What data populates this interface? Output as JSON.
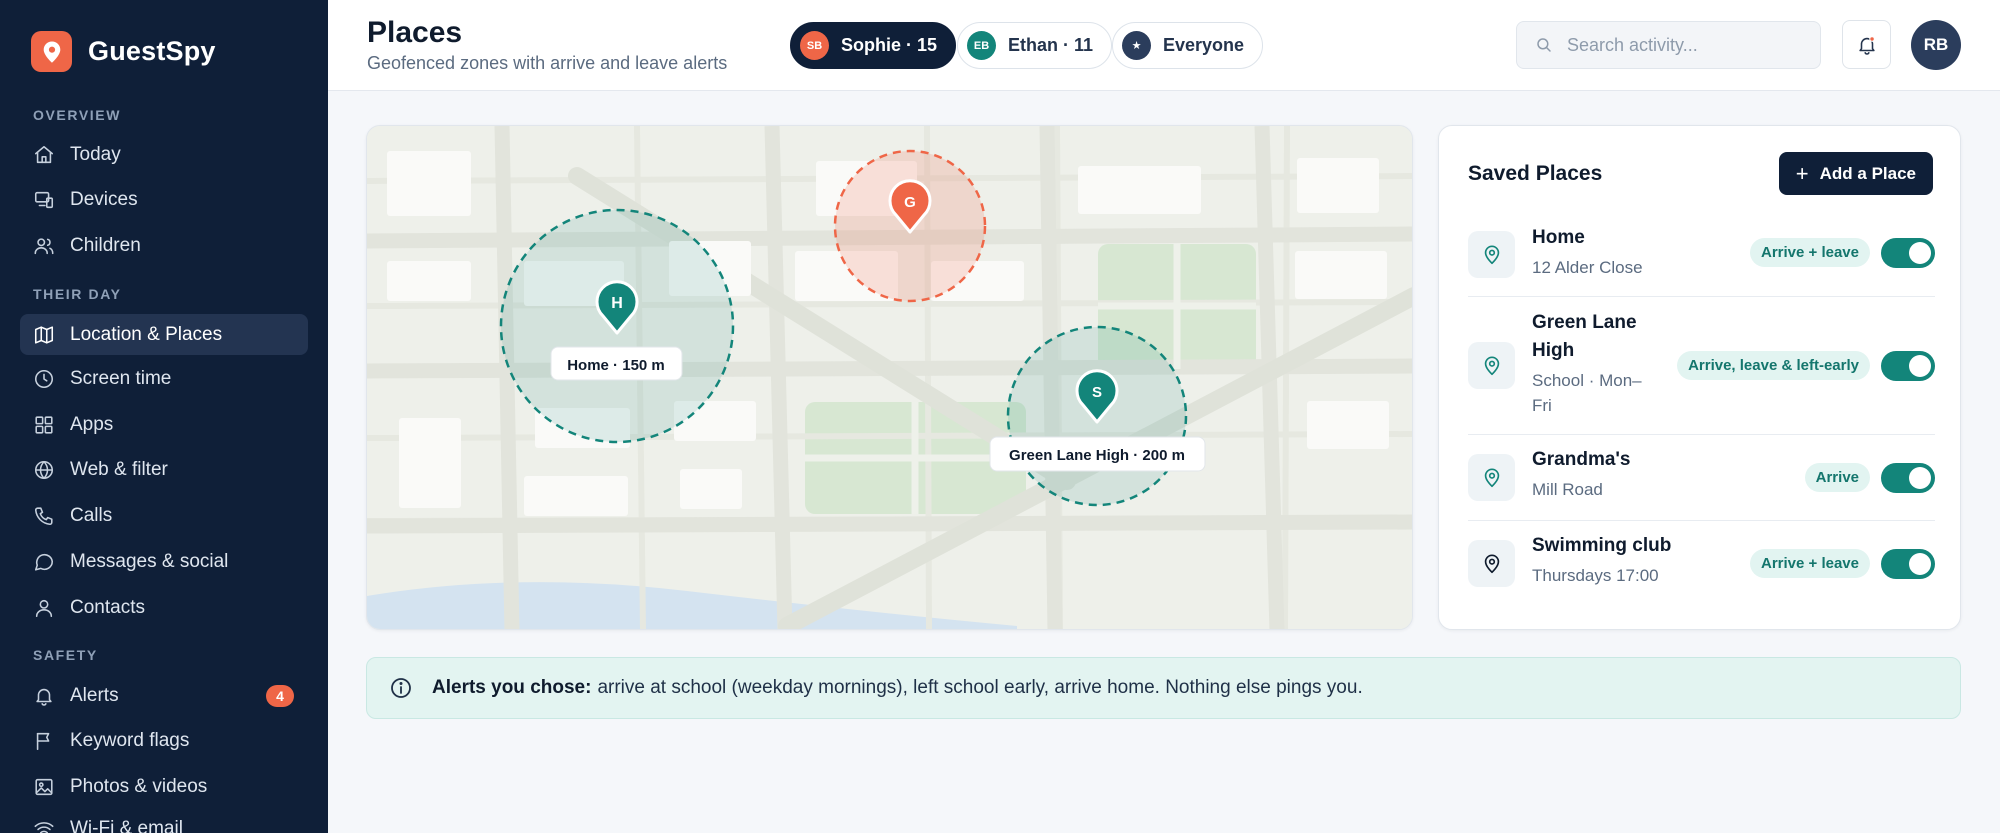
{
  "app": {
    "name": "GuestSpy"
  },
  "sidebar": {
    "sections": {
      "overview": "OVERVIEW",
      "their_day": "THEIR DAY",
      "safety": "SAFETY"
    },
    "items": {
      "today": "Today",
      "devices": "Devices",
      "children": "Children",
      "location": "Location & Places",
      "screen_time": "Screen time",
      "apps": "Apps",
      "web": "Web & filter",
      "calls": "Calls",
      "messages": "Messages & social",
      "contacts": "Contacts",
      "alerts": "Alerts",
      "alerts_badge": "4",
      "keyword": "Keyword flags",
      "photos": "Photos & videos",
      "wifi": "Wi-Fi & email"
    }
  },
  "header": {
    "title": "Places",
    "subtitle": "Geofenced zones with arrive and leave alerts",
    "chips": [
      {
        "initials": "SB",
        "label": "Sophie · 15",
        "color": "#ef6647",
        "active": true
      },
      {
        "initials": "EB",
        "label": "Ethan · 11",
        "color": "#13857a",
        "active": false
      },
      {
        "initials": "★",
        "label": "Everyone",
        "color": "#2b3d5c",
        "active": false
      }
    ],
    "search_placeholder": "Search activity...",
    "avatar": "RB"
  },
  "map": {
    "zones": [
      {
        "marker": "H",
        "label": "Home · 150 m",
        "color": "#13857a"
      },
      {
        "marker": "G",
        "label": "",
        "color": "#ef6647"
      },
      {
        "marker": "S",
        "label": "Green Lane High · 200 m",
        "color": "#13857a"
      }
    ]
  },
  "places": {
    "title": "Saved Places",
    "add_label": "Add a Place",
    "items": [
      {
        "name": "Home",
        "sub": "12 Alder Close",
        "badge": "Arrive + leave",
        "enabled": true
      },
      {
        "name_line1": "Green Lane",
        "name_line2": "High",
        "sub_line1": "School · Mon–",
        "sub_line2": "Fri",
        "badge": "Arrive, leave & left-early",
        "enabled": true
      },
      {
        "name": "Grandma's",
        "sub": "Mill Road",
        "badge": "Arrive",
        "enabled": true
      },
      {
        "name": "Swimming club",
        "sub": "Thursdays 17:00",
        "badge": "Arrive + leave",
        "enabled": true
      }
    ]
  },
  "note": {
    "bold": "Alerts you chose:",
    "text": "arrive at school (weekday mornings), left school early, arrive home. Nothing else pings you."
  }
}
